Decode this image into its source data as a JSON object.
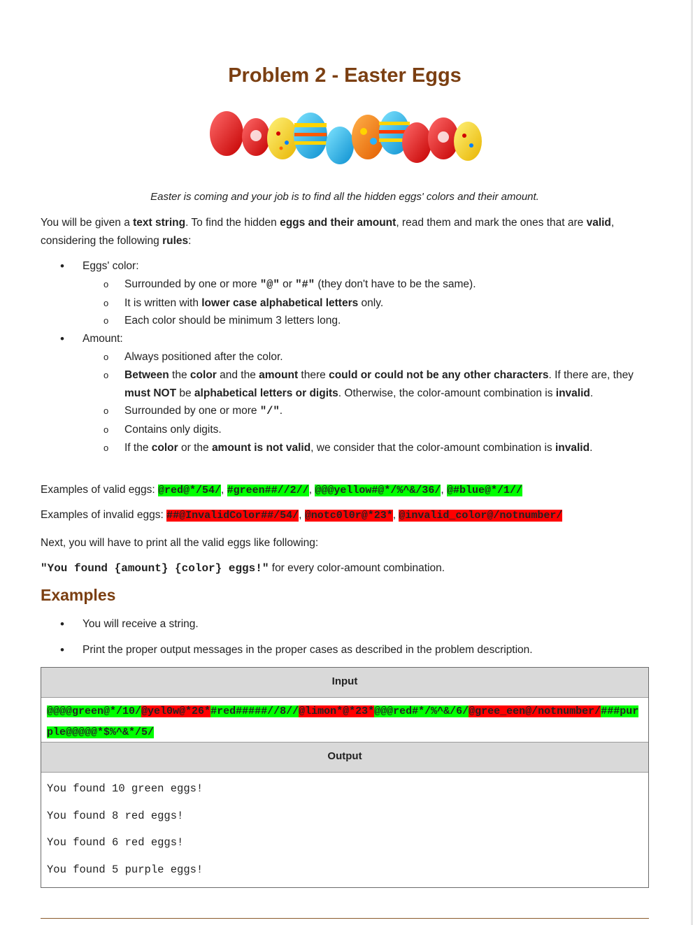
{
  "title": "Problem 2 - Easter Eggs",
  "intro": "Easter is coming and your job is to find all the hidden eggs' colors and their amount.",
  "para1": {
    "t1": "You will be given a ",
    "b1": "text string",
    "t2": ". To find the hidden ",
    "b2": "eggs and their amount",
    "t3": ", read them and mark the ones that are ",
    "b3": "valid",
    "t4": ", considering the following ",
    "b4": "rules",
    "t5": ":"
  },
  "rules": {
    "color_label": "Eggs' color:",
    "color_items": {
      "c1_t1": "Surrounded by one or more ",
      "c1_m1": "\"@\"",
      "c1_t2": " or ",
      "c1_m2": "\"#\"",
      "c1_t3": "  (they don't have to be the same).",
      "c2_t1": "It is written with ",
      "c2_b1": "lower case alphabetical letters",
      "c2_t2": " only.",
      "c3": "Each color should be minimum 3 letters long."
    },
    "amount_label": "Amount:",
    "amount_items": {
      "a1": "Always positioned after the color.",
      "a2_b1": "Between",
      "a2_t1": " the ",
      "a2_b2": "color",
      "a2_t2": " and the ",
      "a2_b3": "amount",
      "a2_t3": " there ",
      "a2_b4": "could or could not be any other characters",
      "a2_t4": ". If there are, they ",
      "a2_b5": "must NOT",
      "a2_t5": " be ",
      "a2_b6": "alphabetical letters or digits",
      "a2_t6": ". Otherwise, the color-amount combination is ",
      "a2_b7": "invalid",
      "a2_t7": ".",
      "a3_t1": "Surrounded by one or more ",
      "a3_m1": "\"/\"",
      "a3_t2": ".",
      "a4": "Contains only digits.",
      "a5_t1": "If the ",
      "a5_b1": "color",
      "a5_t2": " or the ",
      "a5_b2": "amount is not valid",
      "a5_t3": ", we consider that the color-amount combination is ",
      "a5_b3": "invalid",
      "a5_t4": "."
    }
  },
  "valid_examples": {
    "label": "Examples of valid eggs: ",
    "items": [
      "@red@*/54/",
      "#green##//2//",
      "@@@yellow#@*/%^&/36/",
      "@#blue@*/1//"
    ]
  },
  "invalid_examples": {
    "label": "Examples of invalid eggs: ",
    "items": [
      "##@InvalidColor##/54/",
      "@notc0l0r@*23*",
      "@invalid_color@/notnumber/"
    ]
  },
  "print_intro": "Next, you will have to print all the valid eggs like following:",
  "print_format": {
    "code": "\"You found {amount} {color} eggs!\"",
    "text": " for every color-amount combination."
  },
  "examples_heading": "Examples",
  "example_bullets": [
    "You will receive a string.",
    "Print the proper output messages in the proper cases as described in the problem description."
  ],
  "io": {
    "input_header": "Input",
    "input_segments": [
      "@@@@green@*/10/",
      "@yel0w@*26*",
      "#red#####//8//",
      "@limon*@*23*",
      "@@@red#*/%^&/6/",
      "@gree_een@/notnumber/",
      "###purple@@@@@*$%^&*/5/"
    ],
    "output_header": "Output",
    "output_lines": [
      "You found 10 green eggs!",
      "You found 8 red eggs!",
      "You found 6 red eggs!",
      "You found 5 purple eggs!"
    ]
  },
  "colors": {
    "heading": "#7b3f12",
    "valid_highlight": "#00ff00",
    "invalid_highlight": "#ff0000",
    "table_header": "#d9d9d9"
  }
}
